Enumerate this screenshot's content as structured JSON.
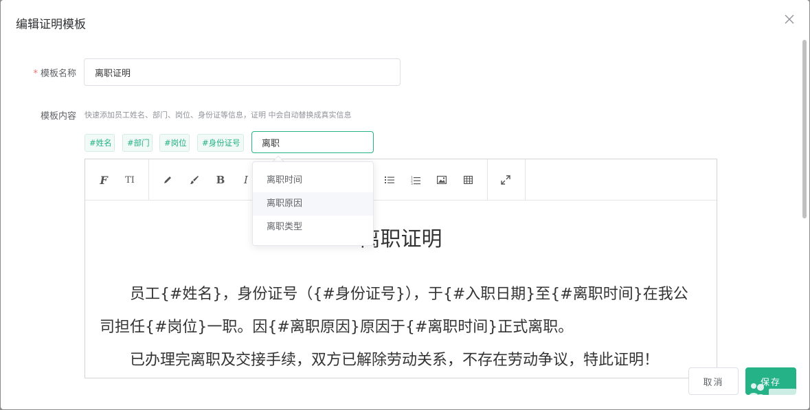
{
  "dialog": {
    "title": "编辑证明模板"
  },
  "form": {
    "name_label": "模板名称",
    "name_required_mark": "*",
    "name_value": "离职证明",
    "content_label": "模板内容",
    "content_hint": "快速添加员工姓名、部门、岗位、身份证等信息，证明 中会自动替换成真实信息"
  },
  "tags": [
    {
      "label": "#姓名"
    },
    {
      "label": "#部门"
    },
    {
      "label": "#岗位"
    },
    {
      "label": "#身份证号"
    }
  ],
  "field_search": {
    "value": "离职"
  },
  "dropdown": {
    "items": [
      {
        "label": "离职时间"
      },
      {
        "label": "离职原因"
      },
      {
        "label": "离职类型"
      }
    ],
    "highlighted_index": 1
  },
  "toolbar": {
    "icons": [
      "font-family-icon",
      "font-size-icon",
      "pencil-icon",
      "brush-icon",
      "bold-icon",
      "italic-icon",
      "unordered-list-icon",
      "ordered-list-icon",
      "image-icon",
      "table-icon",
      "fullscreen-icon"
    ],
    "bold_glyph": "B",
    "italic_glyph": "I",
    "font_family_glyph": "F",
    "font_size_glyph": "TI"
  },
  "document": {
    "title": "离职证明",
    "paragraph1": "员工{#姓名}，身份证号（{#身份证号}），于{#入职日期}至{#离职时间}在我公司担任{#岗位}一职。因{#离职原因}原因于{#离职时间}正式离职。",
    "paragraph2": "已办理完离职及交接手续，双方已解除劳动关系，不存在劳动争议，特此证明！"
  },
  "footer": {
    "cancel_label": "取消",
    "save_label": "保存"
  },
  "colors": {
    "accent": "#24b286",
    "required": "#f56c6c"
  }
}
